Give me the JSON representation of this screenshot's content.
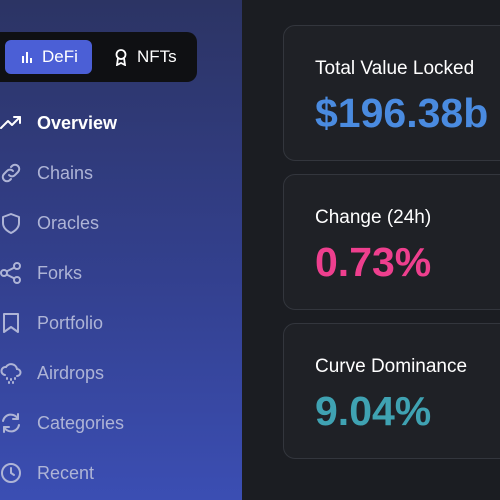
{
  "toggle": {
    "defi_label": "DeFi",
    "nfts_label": "NFTs"
  },
  "nav": {
    "items": [
      {
        "label": "Overview",
        "icon": "trending-up-icon"
      },
      {
        "label": "Chains",
        "icon": "link-icon"
      },
      {
        "label": "Oracles",
        "icon": "shield-icon"
      },
      {
        "label": "Forks",
        "icon": "share-icon"
      },
      {
        "label": "Portfolio",
        "icon": "bookmark-icon"
      },
      {
        "label": "Airdrops",
        "icon": "cloud-rain-icon"
      },
      {
        "label": "Categories",
        "icon": "refresh-icon"
      },
      {
        "label": "Recent",
        "icon": "clock-icon"
      }
    ]
  },
  "stats": {
    "tvl": {
      "title": "Total Value Locked",
      "value": "$196.38b",
      "color": "#4a8be0"
    },
    "change": {
      "title": "Change (24h)",
      "value": "0.73%",
      "color": "#ee3f8e"
    },
    "dominance": {
      "title": "Curve Dominance",
      "value": "9.04%",
      "color": "#3fa2b2"
    }
  },
  "colors": {
    "sidebar_top": "#2c3464",
    "sidebar_bottom": "#3b4eb3",
    "accent": "#4b5fd6",
    "background": "#1b1d22"
  }
}
